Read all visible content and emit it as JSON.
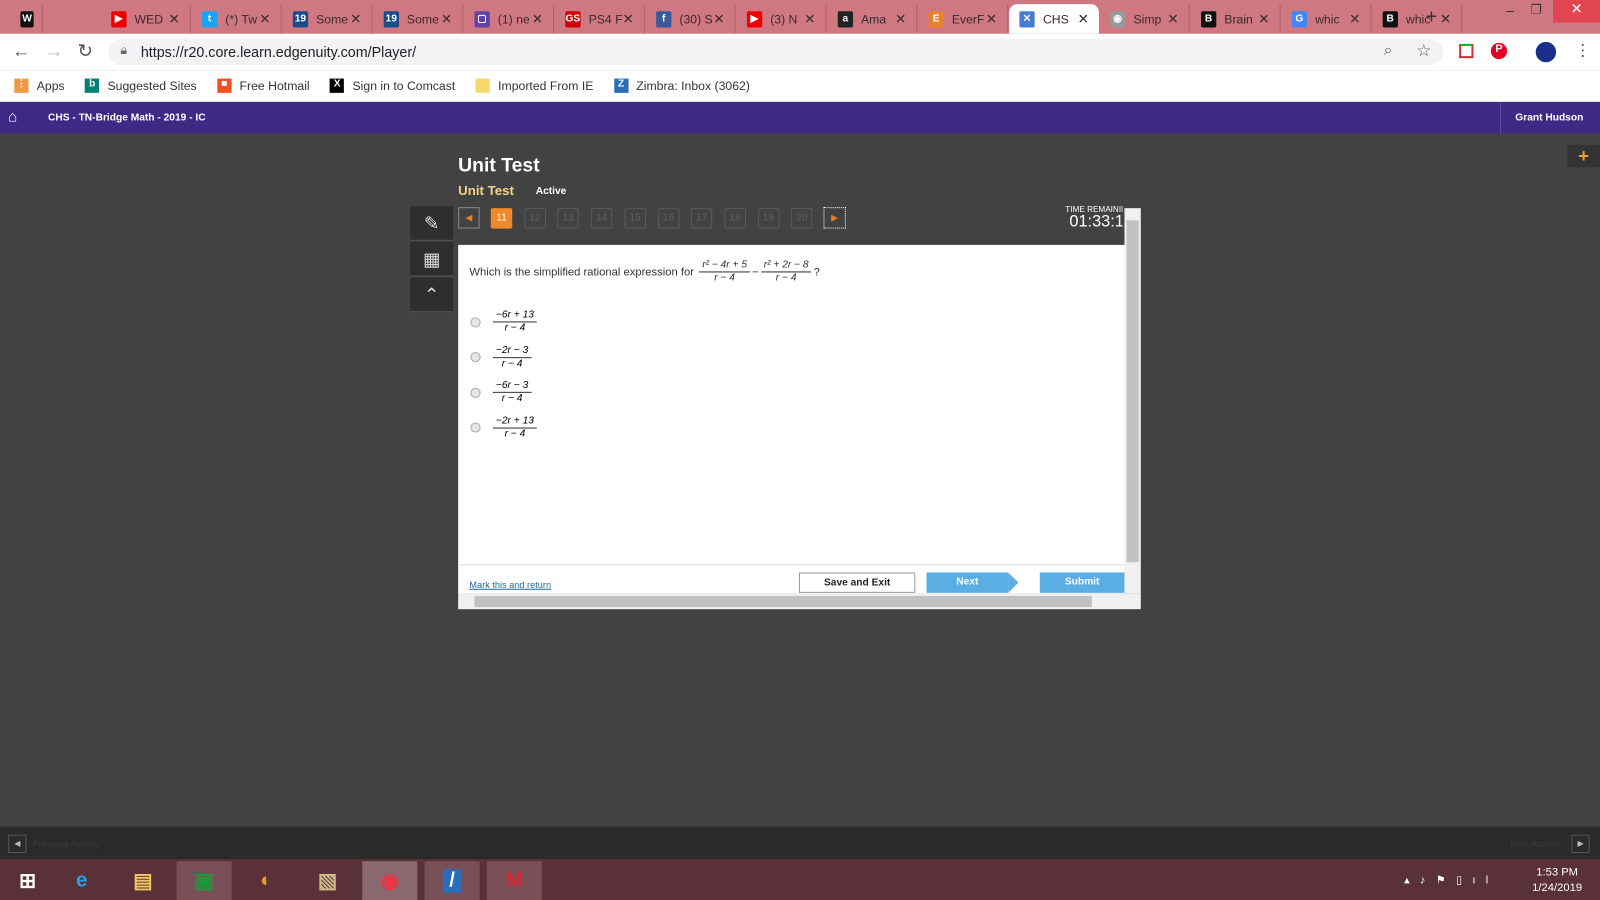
{
  "browser": {
    "tabs": [
      {
        "title": "",
        "icon": "W",
        "color": "#111"
      },
      {
        "title": "WED",
        "icon": "▶",
        "color": "#e00"
      },
      {
        "title": "(*) Tw",
        "icon": "t",
        "color": "#1da1f2"
      },
      {
        "title": "Some",
        "icon": "19",
        "color": "#1a4c8c"
      },
      {
        "title": "Some",
        "icon": "19",
        "color": "#1a4c8c"
      },
      {
        "title": "(1) ne",
        "icon": "▢",
        "color": "#6441a5"
      },
      {
        "title": "PS4 F",
        "icon": "GS",
        "color": "#c00"
      },
      {
        "title": "(30) S",
        "icon": "f",
        "color": "#3b5998"
      },
      {
        "title": "(3) N",
        "icon": "▶",
        "color": "#e00"
      },
      {
        "title": "Ama",
        "icon": "a",
        "color": "#222"
      },
      {
        "title": "EverF",
        "icon": "E",
        "color": "#e8812e"
      },
      {
        "title": "CHS",
        "icon": "✕",
        "color": "#4a7bd0",
        "active": true
      },
      {
        "title": "Simp",
        "icon": "◉",
        "color": "#999"
      },
      {
        "title": "Brain",
        "icon": "B",
        "color": "#111"
      },
      {
        "title": "whic",
        "icon": "G",
        "color": "#4285f4"
      },
      {
        "title": "whic",
        "icon": "B",
        "color": "#111"
      }
    ],
    "url": "https://r20.core.learn.edgenuity.com/Player/",
    "bookmarks": [
      {
        "label": "Apps",
        "icon": "⋮",
        "color": "#e94"
      },
      {
        "label": "Suggested Sites",
        "icon": "b",
        "color": "#008373"
      },
      {
        "label": "Free Hotmail",
        "icon": "■",
        "color": "#f25022"
      },
      {
        "label": "Sign in to Comcast",
        "icon": "X",
        "color": "#000"
      },
      {
        "label": "Imported From IE",
        "icon": "",
        "color": "#f6d86b"
      },
      {
        "label": "Zimbra: Inbox (3062)",
        "icon": "Z",
        "color": "#2a6ebb"
      }
    ]
  },
  "app": {
    "course": "CHS - TN-Bridge Math - 2019 - IC",
    "user": "Grant Hudson",
    "title": "Unit Test",
    "subtitle": "Unit Test",
    "status": "Active",
    "questions": [
      "11",
      "12",
      "13",
      "14",
      "15",
      "16",
      "17",
      "18",
      "19",
      "20"
    ],
    "current": "11",
    "time_label": "TIME REMAINING",
    "time": "01:33:1",
    "question_text": "Which is the simplified rational expression for",
    "expr1": {
      "num": "r² − 4r + 5",
      "den": "r − 4"
    },
    "minus": "−",
    "expr2": {
      "num": "r² + 2r − 8",
      "den": "r − 4"
    },
    "qmark": "?",
    "options": [
      {
        "num": "−6r + 13",
        "den": "r − 4"
      },
      {
        "num": "−2r − 3",
        "den": "r − 4"
      },
      {
        "num": "−6r − 3",
        "den": "r − 4"
      },
      {
        "num": "−2r + 13",
        "den": "r − 4"
      }
    ],
    "mark_link": "Mark this and return",
    "save_exit": "Save and Exit",
    "next": "Next",
    "submit": "Submit",
    "prev_activity": "Previous Activity",
    "next_activity": "Next Activity"
  },
  "taskbar": {
    "time": "1:53 PM",
    "date": "1/24/2019"
  }
}
